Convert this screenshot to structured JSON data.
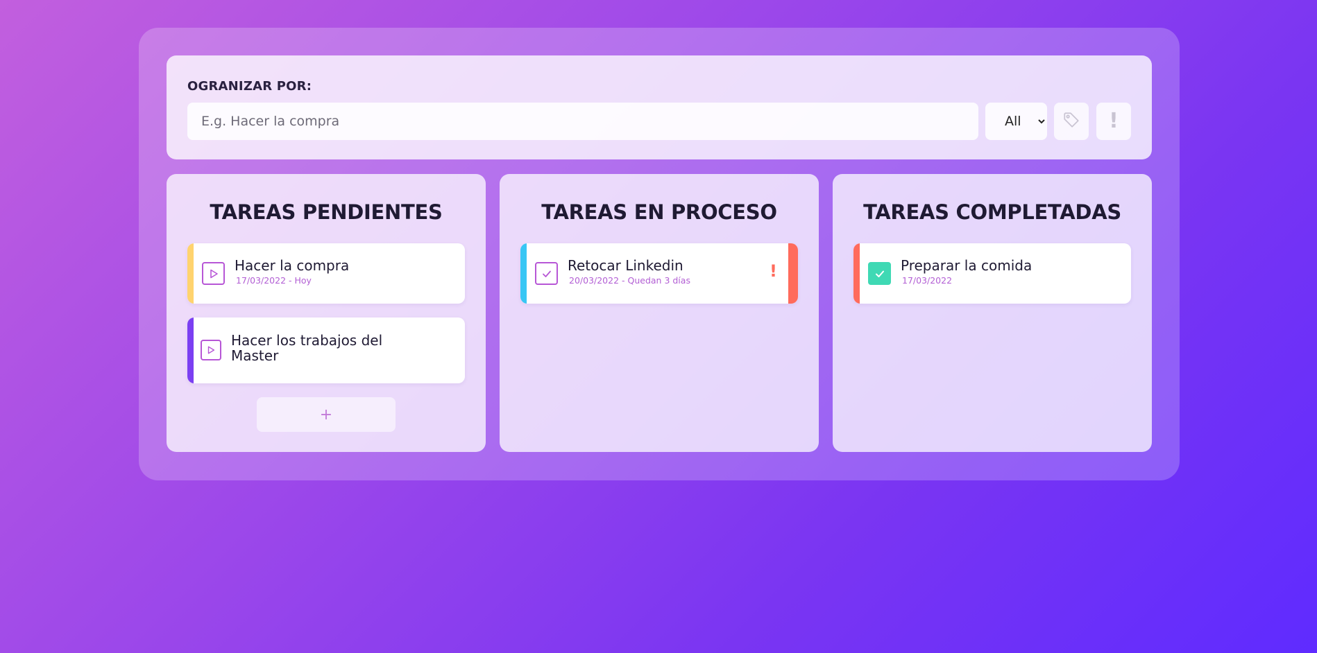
{
  "toolbar": {
    "label": "OGRANIZAR POR:",
    "search_placeholder": "E.g. Hacer la compra",
    "filter_selected": "All",
    "tag_icon": "tag-icon",
    "priority_glyph": "!"
  },
  "columns": [
    {
      "title": "TAREAS PENDIENTES",
      "cards": [
        {
          "title": "Hacer la compra",
          "date": "17/03/2022 - Hoy",
          "color": "#ffd36e",
          "icon": "play-icon"
        },
        {
          "title_line1": "Hacer los trabajos del",
          "title_line2": "Master",
          "color": "#7b3ff2",
          "icon": "play-icon"
        }
      ],
      "add_label": "+"
    },
    {
      "title": "TAREAS EN PROCESO",
      "cards": [
        {
          "title": "Retocar Linkedin",
          "date": "20/03/2022 - Quedan 3 días",
          "color": "#38c6f4",
          "priority_color": "#ff6b5c",
          "alert": "!",
          "icon": "check-icon"
        }
      ]
    },
    {
      "title": "TAREAS COMPLETADAS",
      "cards": [
        {
          "title": "Preparar la comida",
          "date": "17/03/2022",
          "color": "#ff6b5c",
          "icon": "check-icon",
          "done_color": "#3fd9b4"
        }
      ]
    }
  ],
  "colors": {
    "accent": "#b756d6",
    "date_text": "#b25ed4"
  }
}
